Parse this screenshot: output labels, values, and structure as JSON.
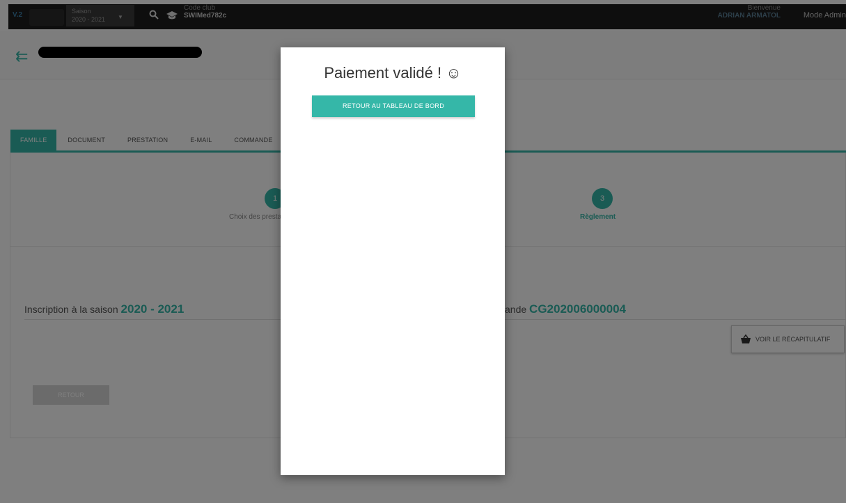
{
  "topbar": {
    "version": "V.2",
    "saison_label": "Saison",
    "saison_value": "2020 - 2021",
    "club_label": "Code club",
    "club_code": "SWIMed782c",
    "welcome_label": "Bienvenue",
    "user_name": "ADRIAN ARMATOL",
    "mode_label": "Mode Admin"
  },
  "tabs": [
    {
      "label": "FAMILLE"
    },
    {
      "label": "DOCUMENT"
    },
    {
      "label": "PRESTATION"
    },
    {
      "label": "E-MAIL"
    },
    {
      "label": "COMMANDE"
    }
  ],
  "stepper": {
    "steps": [
      {
        "number": "1",
        "label": "Choix des prestations"
      },
      {
        "number": "3",
        "label": "Règlement"
      }
    ]
  },
  "main": {
    "inscription_label": "Inscription à la saison",
    "inscription_value": "2020 - 2021",
    "commande_label": "ande",
    "commande_value": "CG202006000004",
    "recap_label": "VOIR LE RÉCAPITULATIF",
    "retour_label": "RETOUR"
  },
  "modal": {
    "title": "Paiement validé ! ☺",
    "button_label": "RETOUR AU TABLEAU DE BORD"
  },
  "colors": {
    "accent": "#35b7a8",
    "topbar": "#1c1c1c"
  }
}
